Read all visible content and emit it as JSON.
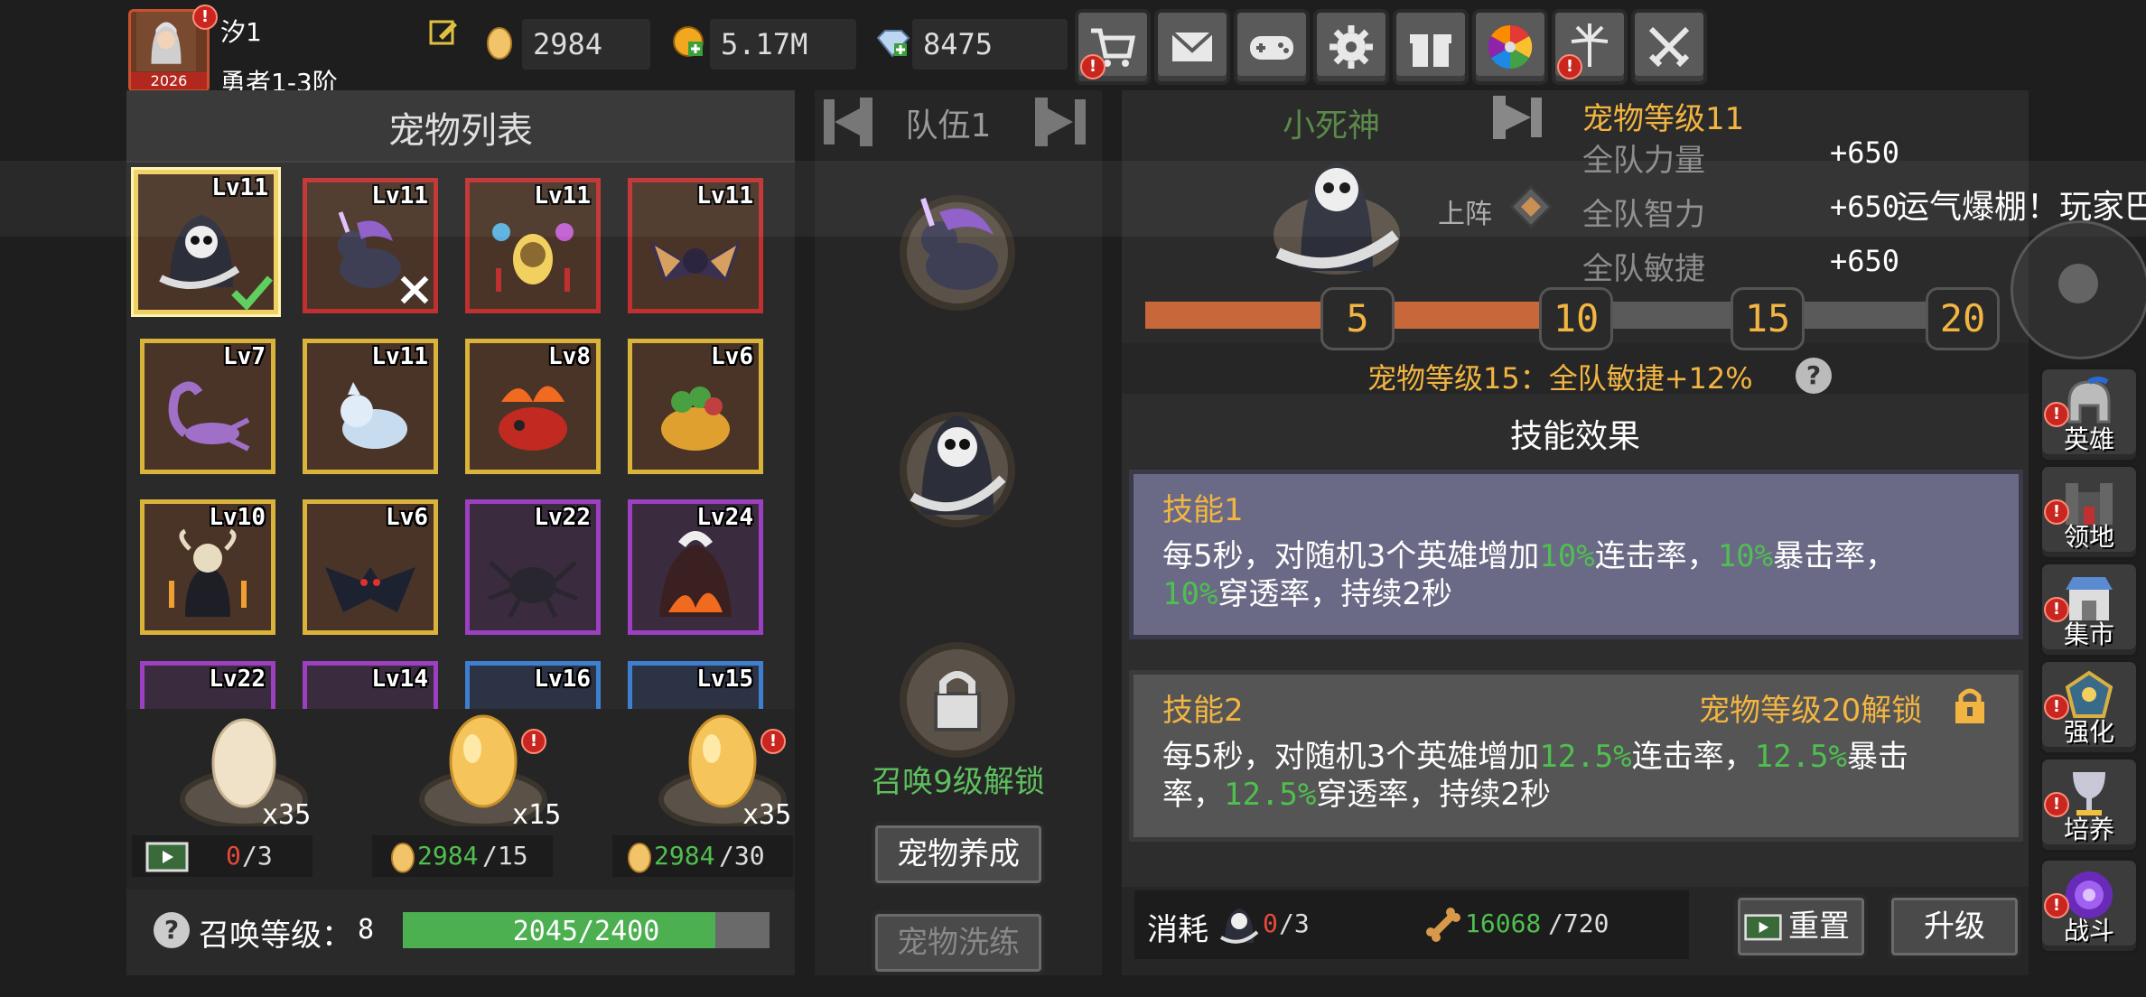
{
  "player": {
    "name": "汐1",
    "title": "勇者1-3阶",
    "avatar_year": "2026"
  },
  "resources": {
    "eggs": "2984",
    "gold": "5.17M",
    "gems": "8475"
  },
  "top_buttons": [
    "cart-icon",
    "mail-icon",
    "gamepad-icon",
    "gear-icon",
    "gift-icon",
    "wheel-icon",
    "fireworks-icon",
    "swords-icon"
  ],
  "pet_list": {
    "title": "宠物列表",
    "pets": [
      {
        "lv": "Lv11",
        "frame": "gold"
      },
      {
        "lv": "Lv11",
        "frame": "red"
      },
      {
        "lv": "Lv11",
        "frame": "red"
      },
      {
        "lv": "Lv11",
        "frame": "red"
      },
      {
        "lv": "Lv7",
        "frame": "gold"
      },
      {
        "lv": "Lv11",
        "frame": "gold"
      },
      {
        "lv": "Lv8",
        "frame": "gold"
      },
      {
        "lv": "Lv6",
        "frame": "gold"
      },
      {
        "lv": "Lv10",
        "frame": "gold"
      },
      {
        "lv": "Lv6",
        "frame": "gold"
      },
      {
        "lv": "Lv22",
        "frame": "purple"
      },
      {
        "lv": "Lv24",
        "frame": "purple"
      },
      {
        "lv": "Lv22",
        "frame": "purple"
      },
      {
        "lv": "Lv14",
        "frame": "purple"
      },
      {
        "lv": "Lv16",
        "frame": "blue"
      },
      {
        "lv": "Lv15",
        "frame": "blue"
      }
    ]
  },
  "eggs": [
    {
      "count": "x35",
      "cost_have": "0",
      "cost_need": "/3"
    },
    {
      "count": "x15",
      "cost_have": "2984",
      "cost_need": "/15"
    },
    {
      "count": "x35",
      "cost_have": "2984",
      "cost_need": "/30"
    }
  ],
  "summon": {
    "label": "召唤等级：",
    "level": "8",
    "progress_text": "2045/2400",
    "progress_fraction": 0.852
  },
  "team": {
    "title": "队伍1",
    "lock_text": "召唤9级解锁",
    "btn_train": "宠物养成",
    "btn_wash": "宠物洗练"
  },
  "detail": {
    "pet_name": "小死神",
    "deploy_label": "上阵",
    "pet_level": "宠物等级11",
    "stats": [
      {
        "name": "全队力量",
        "value": "+650"
      },
      {
        "name": "全队智力",
        "value": "+650"
      },
      {
        "name": "全队敏捷",
        "value": "+650"
      }
    ],
    "milestones": [
      "5",
      "10",
      "15",
      "20"
    ],
    "milestone_fill_fraction": 0.53,
    "next_bonus": "宠物等级15：全队敏捷+12%",
    "skills_title": "技能效果",
    "skill1": {
      "name": "技能1",
      "p1": "每5秒，对随机3个英雄增加",
      "v1": "10%",
      "p2": "连击率，",
      "v2": "10%",
      "p3": "暴击率，",
      "v3": "10%",
      "p4": "穿透率，持续2秒"
    },
    "skill2": {
      "name": "技能2",
      "unlock": "宠物等级20解锁",
      "p1": "每5秒，对随机3个英雄增加",
      "v1": "12.5%",
      "p2": "连击率，",
      "v2": "12.5%",
      "p3": "暴击",
      "p3b": "率，",
      "v3": "12.5%",
      "p4": "穿透率，持续2秒"
    },
    "cost_label": "消耗",
    "cost1_have": "0",
    "cost1_need": "/3",
    "cost2_have": "16068",
    "cost2_need": "/720",
    "btn_reset": "重置",
    "btn_upgrade": "升级"
  },
  "toast": "运气爆棚！玩家巴",
  "side_nav": [
    "英雄",
    "领地",
    "集市",
    "强化",
    "培养",
    "战斗"
  ],
  "colors": {
    "accent_orange": "#f2b542",
    "green": "#4fbf4f",
    "bar_fill": "#c8673a",
    "progress": "#4caf50"
  }
}
